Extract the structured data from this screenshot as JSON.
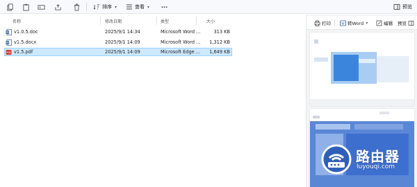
{
  "toolbar": {
    "sort_label": "排序",
    "view_label": "查看",
    "more_label": "···",
    "preview_label": "预览"
  },
  "columns": {
    "name": "名称",
    "modified": "修改日期",
    "type": "类型",
    "size": "大小"
  },
  "files": [
    {
      "name": "v1.0.5.doc",
      "modified": "2025/9/1 14:34",
      "type": "Microsoft Word ...",
      "size": "313 KB",
      "icon": "word-doc-icon"
    },
    {
      "name": "v1.5.docx",
      "modified": "2025/9/1 14:09",
      "type": "Microsoft Word ...",
      "size": "1,312 KB",
      "icon": "word-doc-icon"
    },
    {
      "name": "v1.5.pdf",
      "modified": "2025/9/1 14:09",
      "type": "Microsoft Edge ...",
      "size": "1,649 KB",
      "icon": "pdf-icon",
      "selected": true
    }
  ],
  "preview_pane": {
    "print_label": "打印",
    "to_word_label": "转Word",
    "edit_label": "编辑",
    "preview_label": "预览"
  },
  "watermark": {
    "title": "路由器",
    "url": "luyouqi.com"
  },
  "colors": {
    "selected_row_bg": "#cde8ff",
    "selected_row_border": "#99d1ff",
    "word_blue": "#2b579a",
    "pdf_red": "#d83b2b",
    "preview_blue": "#3a7bd5"
  }
}
